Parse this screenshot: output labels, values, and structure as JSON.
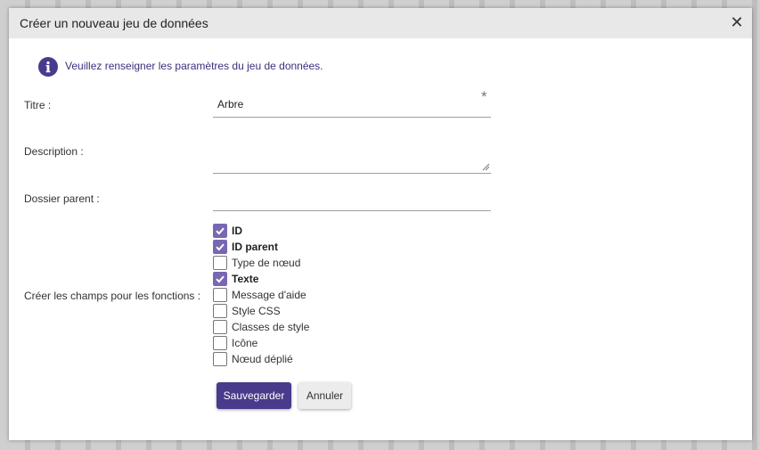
{
  "dialog": {
    "title": "Créer un nouveau jeu de données",
    "close_icon": "close-icon"
  },
  "info": {
    "icon": "info-icon",
    "text": "Veuillez renseigner les paramètres du jeu de données.",
    "color": "#3c2f7d"
  },
  "form": {
    "title_label": "Titre :",
    "title_value": "Arbre",
    "required_mark": "*",
    "description_label": "Description :",
    "description_value": "",
    "parent_label": "Dossier parent :",
    "parent_value": "",
    "fields_label": "Créer les champs pour les fonctions :",
    "functions": [
      {
        "label": "ID",
        "checked": true
      },
      {
        "label": "ID parent",
        "checked": true
      },
      {
        "label": "Type de nœud",
        "checked": false
      },
      {
        "label": "Texte",
        "checked": true
      },
      {
        "label": "Message d'aide",
        "checked": false
      },
      {
        "label": "Style CSS",
        "checked": false
      },
      {
        "label": "Classes de style",
        "checked": false
      },
      {
        "label": "Icône",
        "checked": false
      },
      {
        "label": "Nœud déplié",
        "checked": false
      }
    ]
  },
  "buttons": {
    "save": "Sauvegarder",
    "cancel": "Annuler"
  },
  "colors": {
    "accent": "#4a3a8c",
    "checkbox_checked": "#7867b2"
  }
}
